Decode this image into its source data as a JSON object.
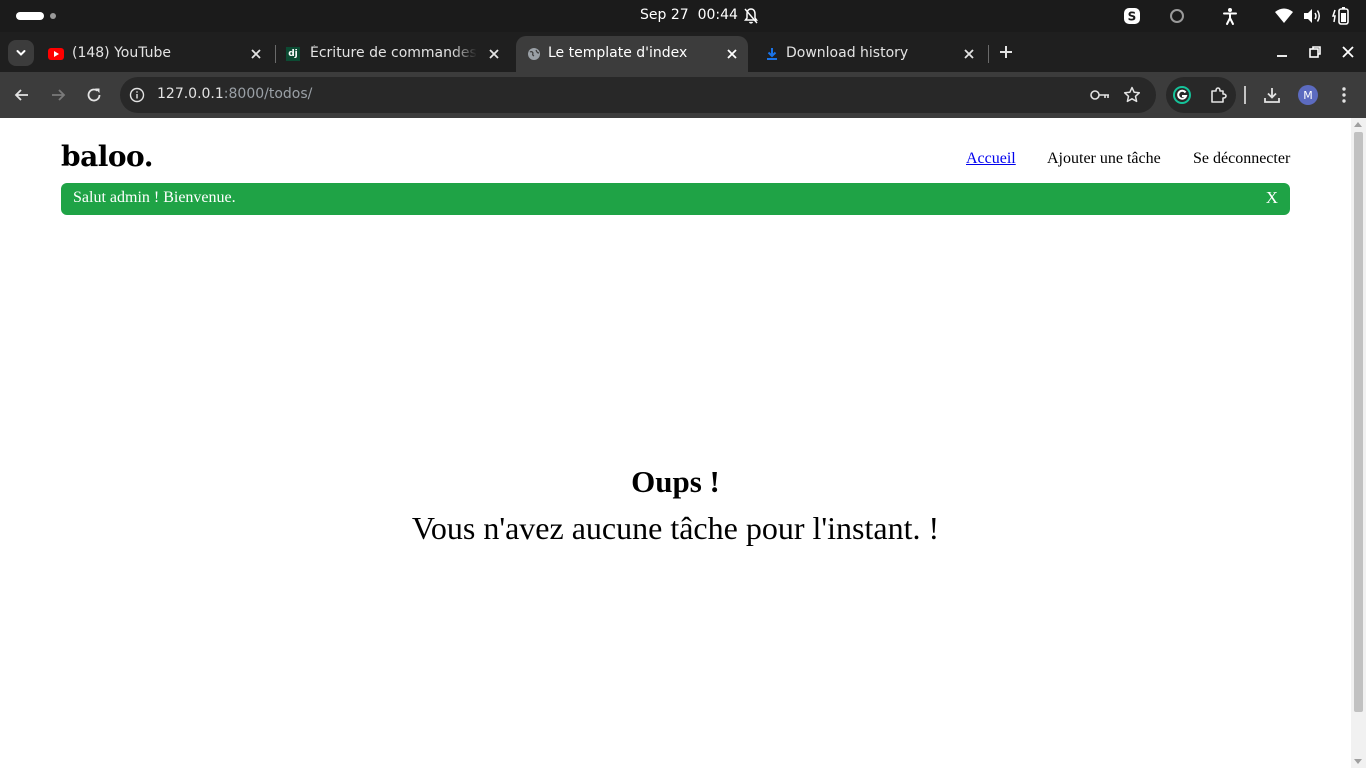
{
  "system_bar": {
    "date": "Sep 27",
    "time": "00:44",
    "icons": [
      "bell-icon",
      "skype-icon",
      "circle-icon",
      "accessibility-icon",
      "wifi-icon",
      "volume-icon",
      "battery-icon"
    ]
  },
  "tabs": [
    {
      "title": "(148) YouTube",
      "icon": "youtube-icon",
      "active": false
    },
    {
      "title": "Écriture de commandes d",
      "icon": "django-icon",
      "active": false
    },
    {
      "title": "Le template d'index",
      "icon": "globe-icon",
      "active": true
    },
    {
      "title": "Download history",
      "icon": "download-icon",
      "active": false
    }
  ],
  "favicon_text": {
    "django": "dj"
  },
  "toolbar": {
    "url_host": "127.0.0.1",
    "url_path": ":8000/todos/",
    "avatar_letter": "M"
  },
  "page": {
    "brand": "baloo.",
    "nav": [
      {
        "label": "Accueil",
        "current": true
      },
      {
        "label": "Ajouter une tâche",
        "current": false
      },
      {
        "label": "Se déconnecter",
        "current": false
      }
    ],
    "alert": {
      "message": "Salut admin ! Bienvenue.",
      "close_label": "X"
    },
    "empty_title": "Oups !",
    "empty_message": "Vous n'avez aucune tâche pour l'instant. !"
  },
  "colors": {
    "alert_bg": "#1fa346",
    "link": "#0000ee",
    "youtube_red": "#ff0000",
    "download_blue": "#1a73e8",
    "django_green": "#0c4b33"
  }
}
